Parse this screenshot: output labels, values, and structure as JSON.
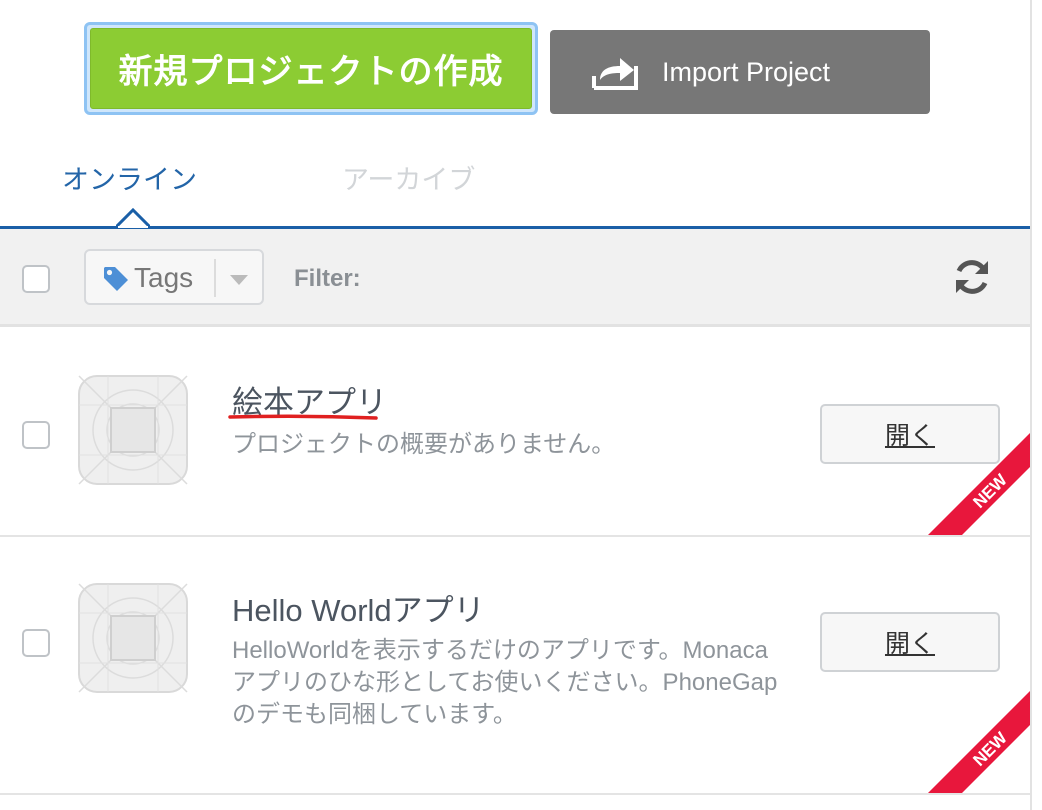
{
  "header": {
    "new_project_label": "新規プロジェクトの作成",
    "import_project_label": "Import Project"
  },
  "tabs": [
    {
      "label": "オンライン",
      "active": true
    },
    {
      "label": "アーカイブ",
      "active": false
    }
  ],
  "toolbar": {
    "tags_label": "Tags",
    "filter_label": "Filter:"
  },
  "projects": [
    {
      "title": "絵本アプリ",
      "description_lines": [
        "プロジェクトの概要がありません。"
      ],
      "open_label": "開く",
      "badge": "NEW"
    },
    {
      "title": "Hello Worldアプリ",
      "description_lines": [
        "HelloWorldを表示するだけのアプリです。Monaca",
        "アプリのひな形としてお使いください。PhoneGap",
        "のデモも同梱しています。"
      ],
      "open_label": "開く",
      "badge": "NEW"
    }
  ],
  "colors": {
    "accent_green": "#8ccc33",
    "import_gray": "#777777",
    "tab_blue": "#1a5fa7",
    "ribbon_red": "#e8173c",
    "annotation_red": "#e02020"
  },
  "icons": [
    "import-arrow-icon",
    "tag-icon",
    "caret-down-icon",
    "refresh-icon",
    "app-placeholder-icon"
  ]
}
